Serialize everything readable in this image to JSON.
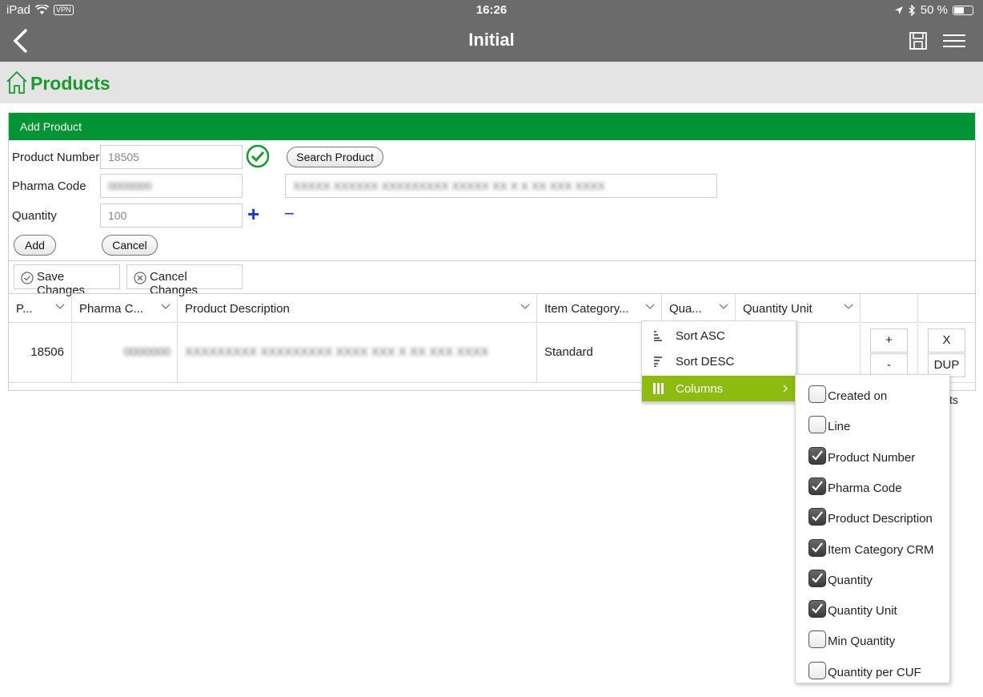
{
  "status_bar": {
    "device": "iPad",
    "vpn": "VPN",
    "time": "16:26",
    "battery": "50 %",
    "battery_level": 0.5
  },
  "nav": {
    "title": "Initial"
  },
  "page": {
    "title": "Products"
  },
  "add_product": {
    "header": "Add Product",
    "product_number_label": "Product Number",
    "product_number_value": "18505",
    "pharma_code_label": "Pharma Code",
    "pharma_code_value": "0000000",
    "description_value": "XXXXX XXXXXX XXXXXXXXX XXXXX XX X X XX XXX XXXX",
    "quantity_label": "Quantity",
    "quantity_value": "100",
    "plus": "+",
    "minus": "−",
    "search_label": "Search Product",
    "add_label": "Add",
    "cancel_label": "Cancel"
  },
  "toolbar": {
    "save_label": "Save Changes",
    "cancel_label": "Cancel Changes"
  },
  "grid": {
    "columns": [
      "P...",
      "Pharma C...",
      "Product Description",
      "Item Category...",
      "Qua...",
      "Quantity Unit"
    ],
    "row": {
      "product_number": "18506",
      "pharma_code": "0000000",
      "description": "XXXXXXXXX XXXXXXXXX XXXX XXX X XX XXX XXXX",
      "item_category": "Standard",
      "plus": "+",
      "minus": "-",
      "x": "X",
      "dup": "DUP"
    },
    "partial_text": "ts"
  },
  "context_menu": {
    "sort_asc": "Sort ASC",
    "sort_desc": "Sort DESC",
    "columns": "Columns"
  },
  "columns_menu": [
    {
      "label": "Created on",
      "checked": false
    },
    {
      "label": "Line",
      "checked": false
    },
    {
      "label": "Product Number",
      "checked": true
    },
    {
      "label": "Pharma Code",
      "checked": true
    },
    {
      "label": "Product Description",
      "checked": true
    },
    {
      "label": "Item Category CRM",
      "checked": true
    },
    {
      "label": "Quantity",
      "checked": true
    },
    {
      "label": "Quantity Unit",
      "checked": true
    },
    {
      "label": "Min Quantity",
      "checked": false
    },
    {
      "label": "Quantity per CUF",
      "checked": false
    }
  ],
  "colors": {
    "green_header": "#009436",
    "title_green": "#1a9a2e",
    "menu_active": "#8dbb10",
    "nav_bg": "#6b6b6b"
  }
}
